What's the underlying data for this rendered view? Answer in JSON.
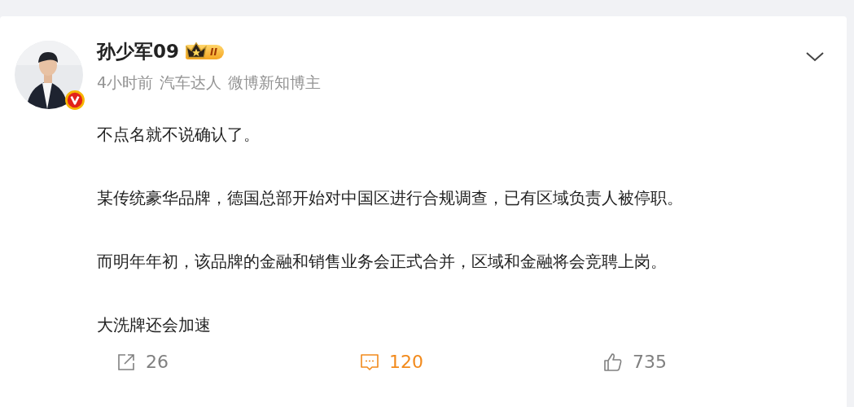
{
  "post": {
    "author": "孙少军09",
    "level_badge": "II",
    "meta": [
      "4小时前",
      "汽车达人",
      "微博新知博主"
    ],
    "paragraphs": [
      "不点名就不说确认了。",
      "某传统豪华品牌，德国总部开始对中国区进行合规调查，已有区域负责人被停职。",
      "而明年年初，该品牌的金融和销售业务会正式合并，区域和金融将会竞聘上岗。",
      "大洗牌还会加速"
    ],
    "actions": [
      {
        "kind": "repost",
        "count": "26",
        "selected": false
      },
      {
        "kind": "comment",
        "count": "120",
        "selected": true
      },
      {
        "kind": "like",
        "count": "735",
        "selected": false
      }
    ]
  }
}
